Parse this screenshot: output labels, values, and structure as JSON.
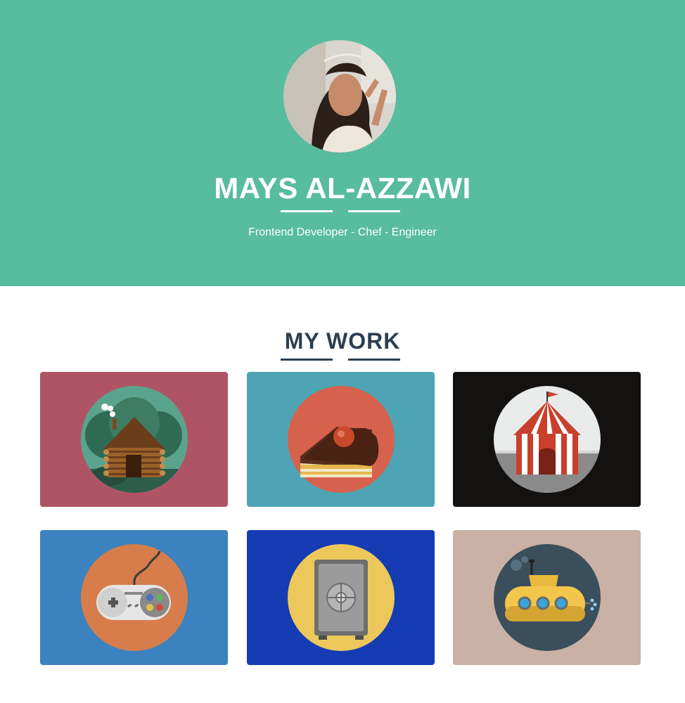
{
  "header": {
    "name": "MAYS AL-AZZAWI",
    "tagline": "Frontend Developer - Chef - Engineer",
    "colors": {
      "background": "#58bc9e",
      "text": "#ffffff"
    }
  },
  "work": {
    "title": "MY WORK",
    "items": [
      {
        "icon": "cabin-icon",
        "background": "#af5466",
        "circle": "#5aa48d"
      },
      {
        "icon": "cake-icon",
        "background": "#4ea4b5",
        "circle": "#d6624d"
      },
      {
        "icon": "circus-tent-icon",
        "background": "#141211",
        "circle": "#e9eaea"
      },
      {
        "icon": "game-controller-icon",
        "background": "#3c82c0",
        "circle": "#d67d4b"
      },
      {
        "icon": "safe-icon",
        "background": "#153cb2",
        "circle": "#ecc85b"
      },
      {
        "icon": "submarine-icon",
        "background": "#c9b1a5",
        "circle": "#3a4e5c"
      }
    ]
  }
}
